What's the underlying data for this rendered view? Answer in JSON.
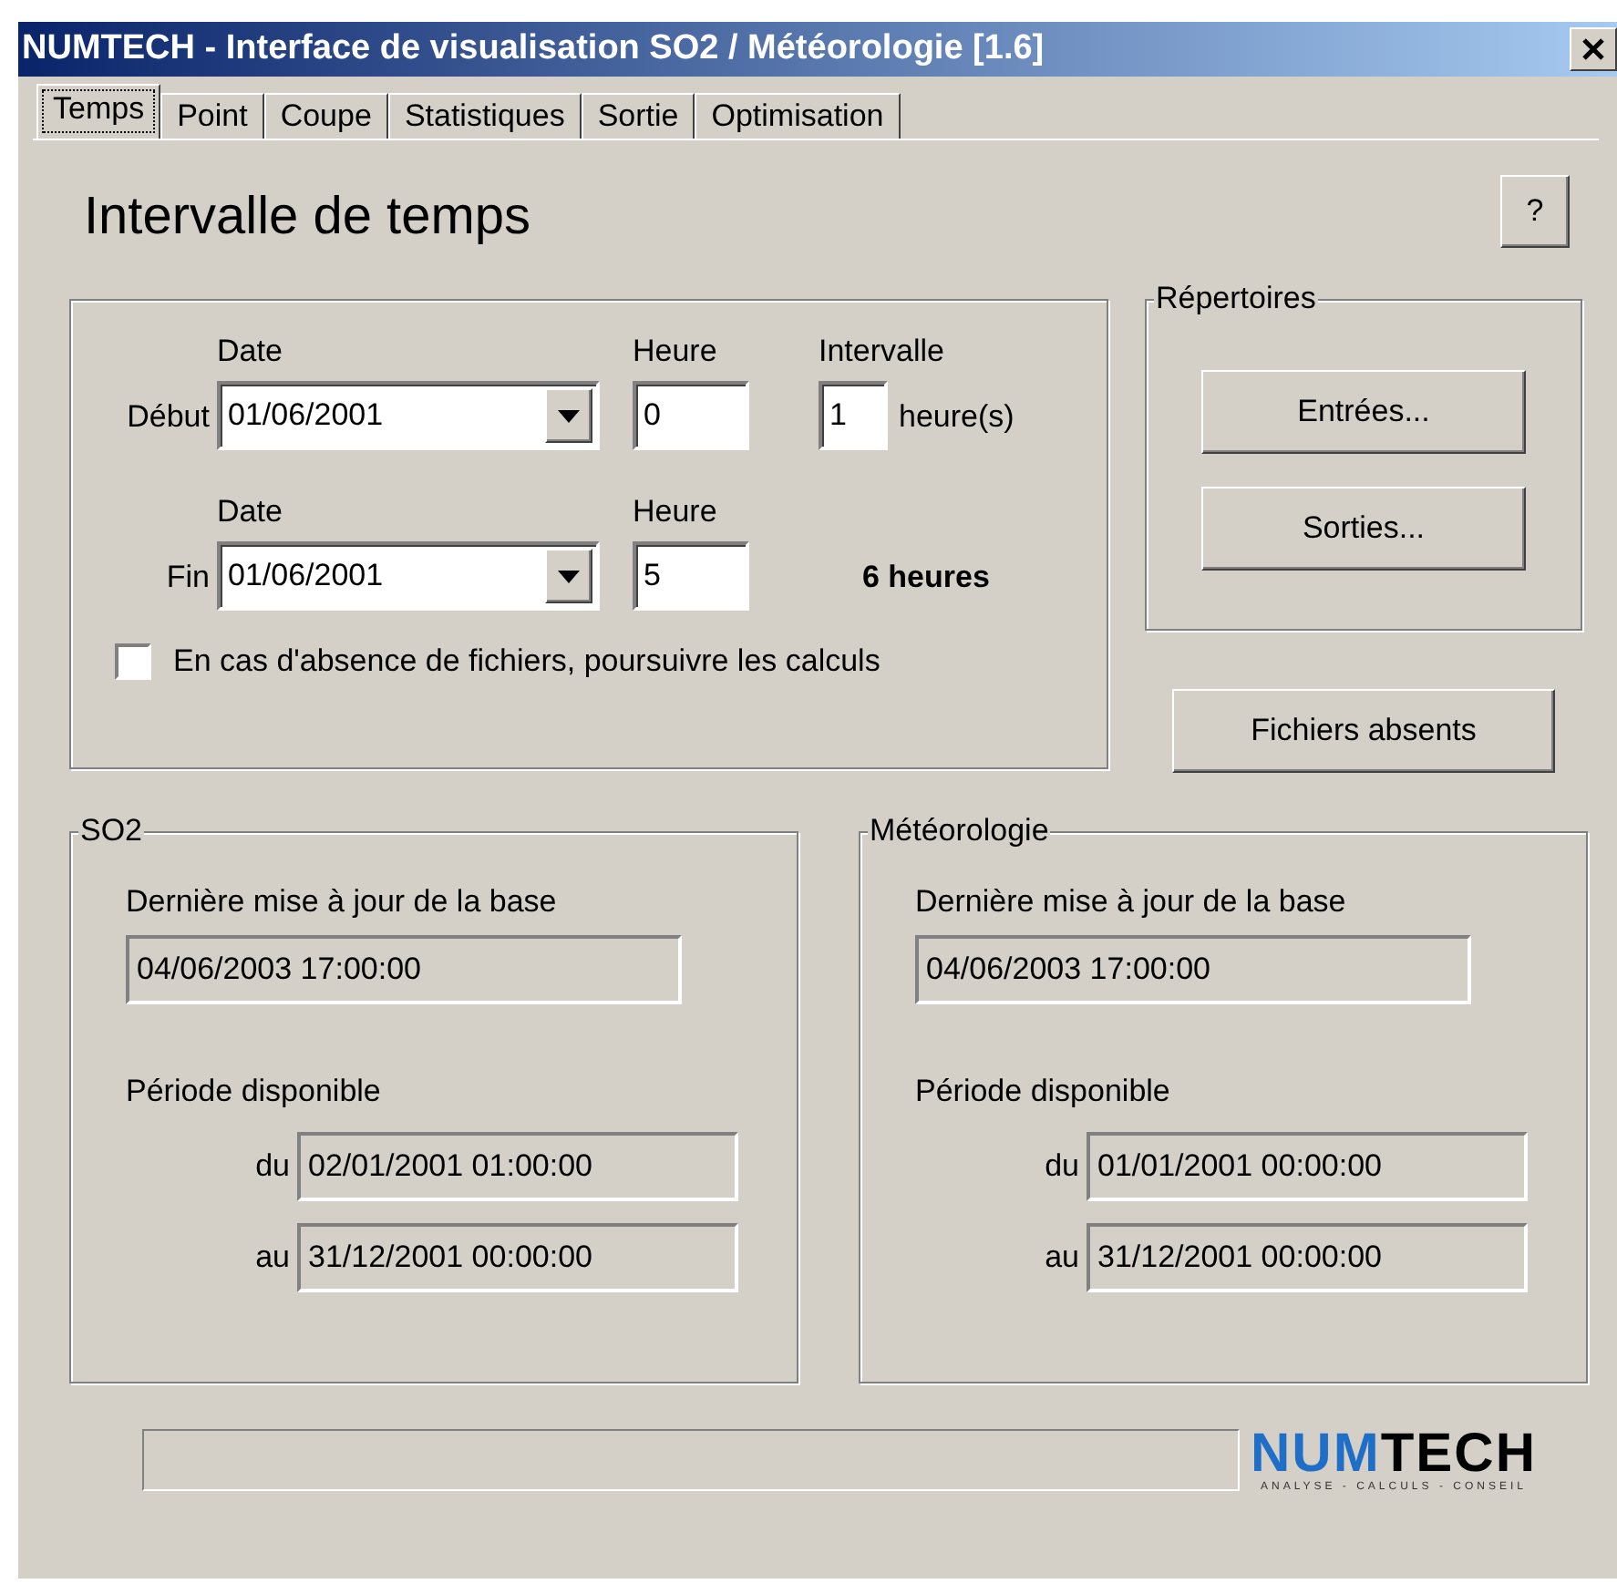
{
  "window": {
    "title": "NUMTECH - Interface de visualisation SO2 / Météorologie [1.6]"
  },
  "tabs": [
    {
      "label": "Temps",
      "selected": true
    },
    {
      "label": "Point",
      "selected": false
    },
    {
      "label": "Coupe",
      "selected": false
    },
    {
      "label": "Statistiques",
      "selected": false
    },
    {
      "label": "Sortie",
      "selected": false
    },
    {
      "label": "Optimisation",
      "selected": false
    }
  ],
  "heading": "Intervalle de temps",
  "help_button": "?",
  "interval": {
    "rows": [
      {
        "label": "Début",
        "date_label": "Date",
        "date": "01/06/2001",
        "hour_label": "Heure",
        "hour": "0",
        "extra_label": "Intervalle",
        "interval": "1",
        "interval_unit": "heure(s)"
      },
      {
        "label": "Fin",
        "date_label": "Date",
        "date": "01/06/2001",
        "hour_label": "Heure",
        "hour": "5",
        "duration": "6 heures"
      }
    ],
    "continue_checkbox": {
      "label": "En cas d'absence de fichiers, poursuivre les calculs",
      "checked": false
    }
  },
  "directories": {
    "title": "Répertoires",
    "buttons": [
      "Entrées...",
      "Sorties..."
    ]
  },
  "missing_files_button": "Fichiers absents",
  "databases": [
    {
      "title": "SO2",
      "update_label": "Dernière mise à jour de la base",
      "update": "04/06/2003 17:00:00",
      "period_label": "Période disponible",
      "from_label": "du",
      "from": "02/01/2001 01:00:00",
      "to_label": "au",
      "to": "31/12/2001 00:00:00"
    },
    {
      "title": "Météorologie",
      "update_label": "Dernière mise à jour de la base",
      "update": "04/06/2003 17:00:00",
      "period_label": "Période disponible",
      "from_label": "du",
      "from": "01/01/2001 00:00:00",
      "to_label": "au",
      "to": "31/12/2001 00:00:00"
    }
  ],
  "progress": {
    "level": 0
  },
  "logo": {
    "primary": "NUM",
    "secondary": "TECH",
    "tagline": "ANALYSE - CALCULS - CONSEIL"
  }
}
